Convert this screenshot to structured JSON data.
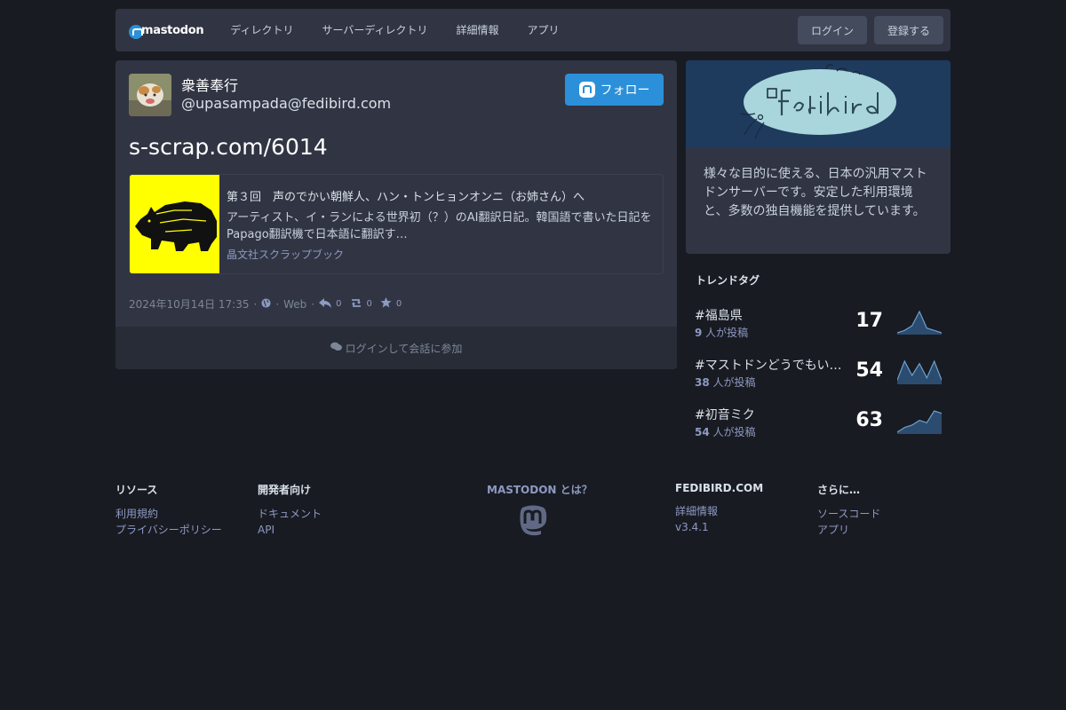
{
  "header": {
    "logo_text": "mastodon",
    "nav": [
      "ディレクトリ",
      "サーバーディレクトリ",
      "詳細情報",
      "アプリ"
    ],
    "login_label": "ログイン",
    "register_label": "登録する"
  },
  "status": {
    "display_name": "衆善奉行",
    "acct": "@upasampada@fedibird.com",
    "follow_label": "フォロー",
    "content": "s-scrap.com/6014",
    "card": {
      "title": "第３回　声のでかい朝鮮人、ハン・トンヒョンオンニ（お姉さん）へ",
      "description": "アーティスト、イ・ランによる世界初（？）のAI翻訳日記。韓国語で書いた日記をPapago翻訳機で日本語に翻訳す…",
      "provider": "晶文社スクラップブック"
    },
    "meta": {
      "datetime": "2024年10月14日 17:35",
      "sep1": "·",
      "sep2": "·",
      "app": "Web",
      "sep3": "·",
      "replies": "0",
      "boosts": "0",
      "favourites": "0"
    },
    "login_prompt": "ログインして会話に参加"
  },
  "server": {
    "description": "様々な目的に使える、日本の汎用マストドンサーバーです。安定した利用環境と、多数の独自機能を提供しています。"
  },
  "trends": {
    "heading": "トレンドタグ",
    "items": [
      {
        "name": "#福島県",
        "people": "9",
        "suffix": " 人が投稿",
        "count": "17",
        "history": [
          0,
          1,
          3,
          9,
          2,
          1,
          0
        ]
      },
      {
        "name": "#マストドンどうでもいい…",
        "people": "38",
        "suffix": " 人が投稿",
        "count": "54",
        "history": [
          1,
          9,
          3,
          8,
          2,
          9,
          1
        ]
      },
      {
        "name": "#初音ミク",
        "people": "54",
        "suffix": " 人が投稿",
        "count": "63",
        "history": [
          0,
          2,
          3,
          5,
          4,
          9,
          8
        ]
      }
    ]
  },
  "footer": {
    "resources": {
      "heading": "リソース",
      "links": [
        "利用規約",
        "プライバシーポリシー"
      ]
    },
    "developers": {
      "heading": "開発者向け",
      "links": [
        "ドキュメント",
        "API"
      ]
    },
    "mastodon_what": "MASTODON とは？",
    "server": {
      "heading": "FEDIBIRD.COM",
      "links": [
        "詳細情報",
        "v3.4.1"
      ]
    },
    "more": {
      "heading": "さらに…",
      "links": [
        "ソースコード",
        "アプリ"
      ]
    }
  },
  "colors": {
    "background": "#191b22",
    "panel": "#313543",
    "accent": "#2b90d9",
    "server_hero": "#1e3b5e",
    "spark_fill": "#2b4c6e",
    "spark_line": "#6ca0d0"
  }
}
